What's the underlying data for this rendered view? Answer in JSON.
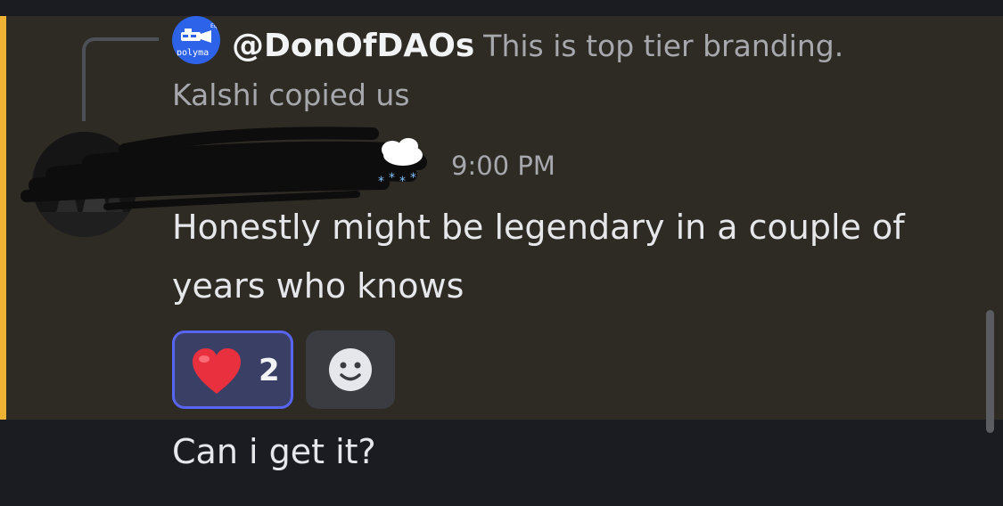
{
  "reply": {
    "author": "@DonOfDAOs",
    "preview_line1": "This is top tier branding.",
    "preview_line2": "Kalshi copied us",
    "avatar_text": "polyma"
  },
  "message": {
    "author": "",
    "timestamp": "9:00 PM",
    "text": "Honestly might be legendary in a couple of years who knows",
    "reactions": [
      {
        "emoji": "heart",
        "count": "2"
      }
    ]
  },
  "next_message": {
    "text": "Can i get it?"
  },
  "colors": {
    "mention_bar": "#f0b232",
    "highlight_bg": "#2e2a24",
    "reaction_border": "#5865f2",
    "reply_avatar": "#2d63e8"
  },
  "icons": {
    "reply_avatar": "polymarket-logo-icon",
    "redacted_name": "scribble-redaction",
    "status_emoji": "snow-cloud-icon",
    "reaction": "red-heart-icon",
    "add_reaction": "smiley-icon"
  }
}
